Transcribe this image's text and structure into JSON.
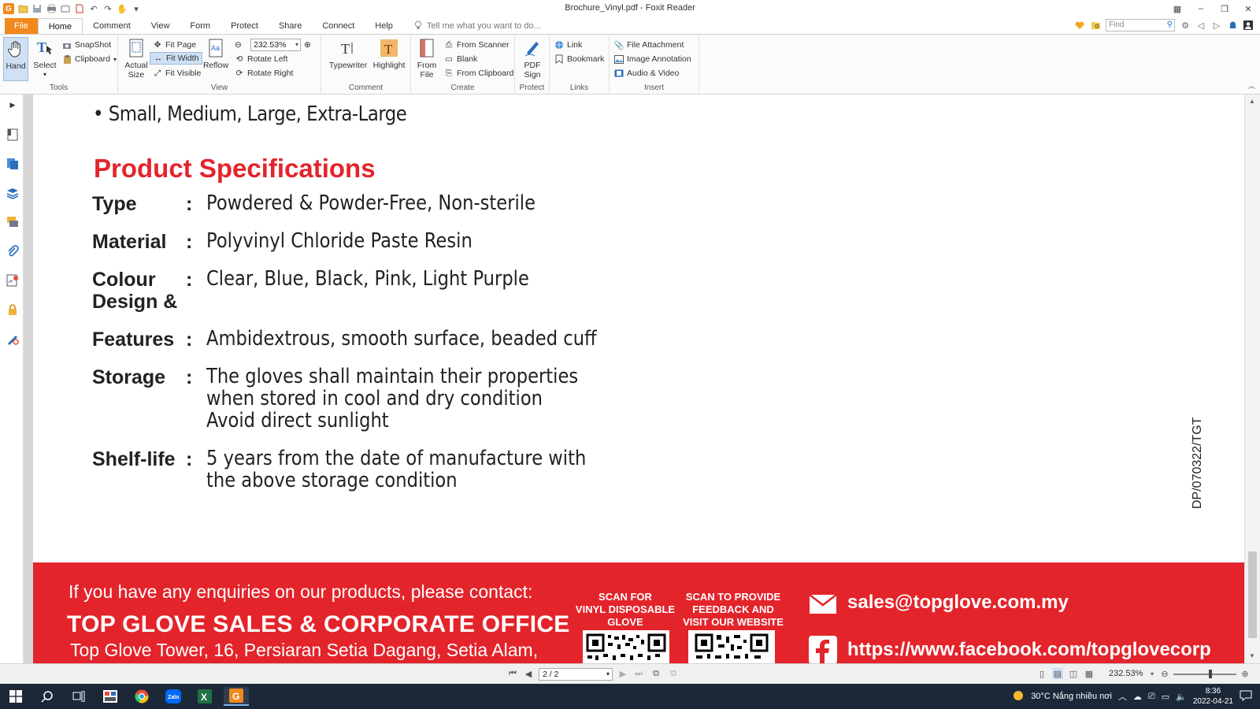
{
  "window": {
    "title": "Brochure_Vinyl.pdf - Foxit Reader",
    "logo_letter": "G"
  },
  "tabs": [
    {
      "label": "File"
    },
    {
      "label": "Home"
    },
    {
      "label": "Comment"
    },
    {
      "label": "View"
    },
    {
      "label": "Form"
    },
    {
      "label": "Protect"
    },
    {
      "label": "Share"
    },
    {
      "label": "Connect"
    },
    {
      "label": "Help"
    }
  ],
  "tell_me": "Tell me what you want to do...",
  "find_placeholder": "Find",
  "ribbon": {
    "tools": {
      "label": "Tools",
      "hand": "Hand",
      "select": "Select",
      "snapshot": "SnapShot",
      "clipboard": "Clipboard"
    },
    "view": {
      "label": "View",
      "actual_size_1": "Actual",
      "actual_size_2": "Size",
      "fit_page": "Fit Page",
      "fit_width": "Fit Width",
      "fit_visible": "Fit Visible",
      "reflow": "Reflow",
      "zoom": "232.53%",
      "rotate_left": "Rotate Left",
      "rotate_right": "Rotate Right"
    },
    "comment": {
      "label": "Comment",
      "typewriter": "Typewriter",
      "highlight": "Highlight"
    },
    "create": {
      "label": "Create",
      "from_file_1": "From",
      "from_file_2": "File",
      "from_scanner": "From Scanner",
      "blank": "Blank",
      "from_clipboard": "From Clipboard"
    },
    "protect": {
      "label": "Protect",
      "pdf_sign_1": "PDF",
      "pdf_sign_2": "Sign"
    },
    "links": {
      "label": "Links",
      "link": "Link",
      "bookmark": "Bookmark"
    },
    "insert": {
      "label": "Insert",
      "file_attachment": "File Attachment",
      "image_annotation": "Image Annotation",
      "audio_video": "Audio & Video"
    }
  },
  "document": {
    "bullet_sizes": "• Small, Medium, Large, Extra-Large",
    "spec_heading": "Product Specifications",
    "specs": [
      {
        "label": "Type",
        "value_lines": [
          "Powdered & Powder-Free, Non-sterile"
        ]
      },
      {
        "label": "Material",
        "value_lines": [
          "Polyvinyl Chloride Paste Resin"
        ]
      },
      {
        "label": "Colour",
        "label2": "Design &",
        "value_lines": [
          "Clear, Blue, Black, Pink, Light Purple"
        ]
      },
      {
        "label": "Features",
        "value_lines": [
          "Ambidextrous, smooth surface, beaded cuff"
        ]
      },
      {
        "label": "Storage",
        "value_lines": [
          "The gloves shall maintain their properties",
          "when stored in cool and dry condition",
          "Avoid direct sunlight"
        ]
      },
      {
        "label": "Shelf-life",
        "value_lines": [
          "5 years from the date of manufacture with",
          "the above storage condition"
        ]
      }
    ],
    "colon": ":",
    "doc_code": "DP/070322/TGT",
    "footer": {
      "enquiry": "If you have any enquiries on our products, please contact:",
      "office": "TOP GLOVE SALES & CORPORATE OFFICE",
      "address": "Top Glove Tower, 16, Persiaran Setia Dagang, Setia Alam,",
      "scan1": [
        "SCAN FOR",
        "VINYL DISPOSABLE",
        "GLOVE"
      ],
      "scan2": [
        "SCAN TO PROVIDE",
        "FEEDBACK AND",
        "VISIT OUR WEBSITE"
      ],
      "email": "sales@topglove.com.my",
      "facebook": "https://www.facebook.com/topglovecorp"
    }
  },
  "status": {
    "page": "2 / 2",
    "zoom": "232.53%"
  },
  "taskbar": {
    "weather": "30°C  Nắng nhiều nơi",
    "time": "8:36",
    "date": "2022-04-21"
  },
  "colors": {
    "accent_orange": "#f08a1d",
    "brand_red": "#e3242b",
    "taskbar": "#1c2838"
  }
}
